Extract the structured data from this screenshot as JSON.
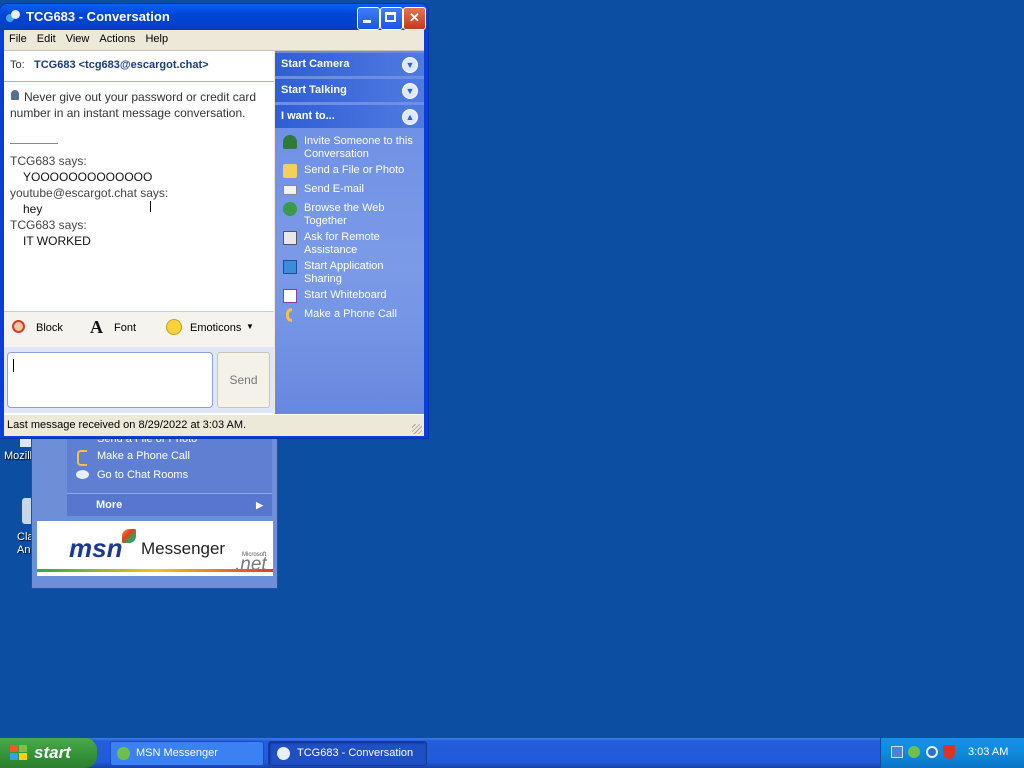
{
  "desktop": {
    "icon1_label": "Mozill",
    "icon2_label_line1": "Cla",
    "icon2_label_line2": "An"
  },
  "background_window": {
    "items": [
      "Send a File or Photo",
      "Make a Phone Call",
      "Go to Chat Rooms"
    ],
    "more_label": "More",
    "logo_msn": "msn",
    "logo_messenger": "Messenger",
    "logo_microsoft": "Microsoft",
    "logo_net": ".net"
  },
  "window": {
    "title": "TCG683 - Conversation",
    "menu": [
      "File",
      "Edit",
      "View",
      "Actions",
      "Help"
    ],
    "to_label": "To:",
    "to_value": "TCG683 <tcg683@escargot.chat>",
    "warning": "Never give out your password or credit card number in an instant message conversation.",
    "history": [
      {
        "sender": "TCG683 says:",
        "message": "YOOOOOOOOOOOOO"
      },
      {
        "sender": "youtube@escargot.chat says:",
        "message": "hey"
      },
      {
        "sender": "TCG683 says:",
        "message": "IT WORKED"
      }
    ],
    "toolbar": {
      "block": "Block",
      "font": "Font",
      "emoticons": "Emoticons"
    },
    "send_label": "Send",
    "status": "Last message received on 8/29/2022 at 3:03 AM."
  },
  "right_panel": {
    "start_camera": "Start Camera",
    "start_talking": "Start Talking",
    "i_want_to": "I want to...",
    "actions": [
      "Invite Someone to this Conversation",
      "Send a File or Photo",
      "Send E-mail",
      "Browse the Web Together",
      "Ask for Remote Assistance",
      "Start Application Sharing",
      "Start Whiteboard",
      "Make a Phone Call"
    ]
  },
  "taskbar": {
    "start": "start",
    "buttons": [
      "MSN Messenger",
      "TCG683 - Conversation"
    ],
    "clock": "3:03 AM"
  },
  "colors": {
    "desktop": "#0b4ea2",
    "title_bar": "#0046d6",
    "panel": "#6a8be3",
    "taskbar": "#225bd9",
    "start_button": "#37953a"
  }
}
